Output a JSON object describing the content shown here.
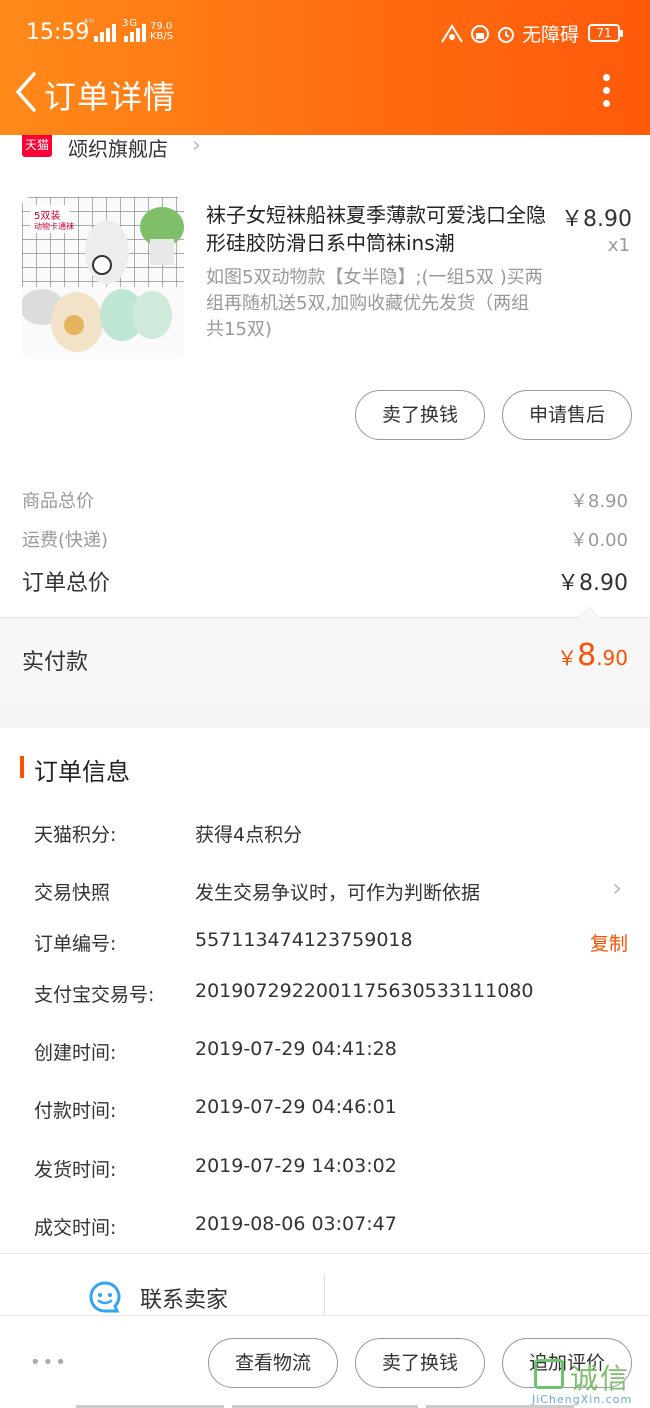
{
  "status_bar": {
    "time": "15:59",
    "network": "⁴ᴳ",
    "network_3g": "3G",
    "speed_value": "79.0",
    "speed_unit": "KB/S",
    "accessibility": "无障碍",
    "battery": "71"
  },
  "nav": {
    "title": "订单详情"
  },
  "shop": {
    "badge": "天猫",
    "name": "颂织旗舰店"
  },
  "product": {
    "title": "袜子女短袜船袜夏季薄款可爱浅口全隐形硅胶防滑日系中筒袜ins潮",
    "price": "￥8.90",
    "quantity": "x1",
    "sku": "如图5双动物款【女半隐】;(一组5双 )买两组再随机送5双,加购收藏优先发货（两组共15双)",
    "image_badge": "5双装",
    "image_badge_sub": "动物卡通袜"
  },
  "item_actions": {
    "sell_button": "卖了换钱",
    "aftersale_button": "申请售后"
  },
  "summary": {
    "goods_total_label": "商品总价",
    "goods_total_value": "￥8.90",
    "shipping_label": "运费(快递)",
    "shipping_value": "￥0.00",
    "order_total_label": "订单总价",
    "order_total_value": "￥8.90"
  },
  "paid": {
    "label": "实付款",
    "currency": "￥",
    "integer": "8",
    "decimal": ".90"
  },
  "order_info": {
    "title": "订单信息",
    "rows": [
      {
        "label": "天猫积分:",
        "value": "获得4点积分"
      },
      {
        "label": "交易快照",
        "value": "发生交易争议时，可作为判断依据"
      },
      {
        "label": "订单编号:",
        "value": "557113474123759018",
        "action": "复制"
      },
      {
        "label": "支付宝交易号:",
        "value": "2019072922001175630533111080"
      },
      {
        "label": "创建时间:",
        "value": "2019-07-29 04:41:28"
      },
      {
        "label": "付款时间:",
        "value": "2019-07-29 04:46:01"
      },
      {
        "label": "发货时间:",
        "value": "2019-07-29 14:03:02"
      },
      {
        "label": "成交时间:",
        "value": "2019-08-06 03:07:47"
      }
    ]
  },
  "contact": {
    "label": "联系卖家"
  },
  "bottom_bar": {
    "more": "•••",
    "logistics_button": "查看物流",
    "sell_button": "卖了换钱",
    "review_button": "追加评价"
  },
  "watermark": {
    "text": "诚信",
    "url": "JiChengXin.com"
  },
  "colors": {
    "header_start": "#ff8a1a",
    "header_end": "#ff5a0a",
    "accent": "#ff5000",
    "tmall": "#ff0036"
  }
}
